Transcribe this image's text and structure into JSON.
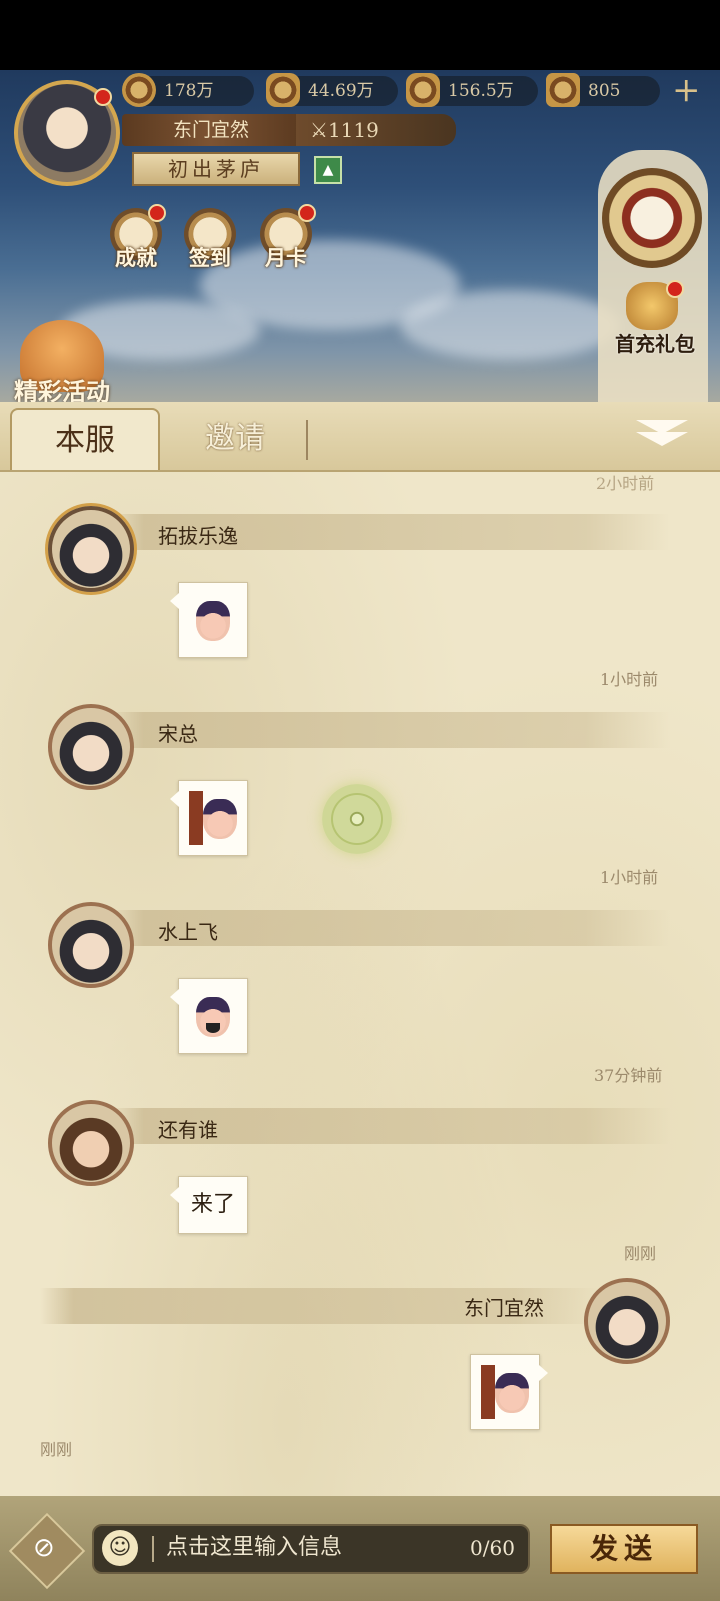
{
  "resources": [
    {
      "name": "coin",
      "value": "178万"
    },
    {
      "name": "scroll",
      "value": "44.69万"
    },
    {
      "name": "brush",
      "value": "156.5万"
    },
    {
      "name": "ticket",
      "value": "805"
    }
  ],
  "add_label": "+",
  "player": {
    "name": "东门宜然",
    "power": "1119",
    "rank": "初出茅庐"
  },
  "shortcuts": [
    {
      "label": "成就"
    },
    {
      "label": "签到"
    },
    {
      "label": "月卡"
    }
  ],
  "right_panel": {
    "gift_label": "首充礼包"
  },
  "event_label": "精彩活动",
  "tabs": [
    {
      "label": "本服",
      "active": true
    },
    {
      "label": "邀请",
      "active": false
    }
  ],
  "top_time_partial": "2小时前",
  "messages": [
    {
      "sender": "拓拔乐逸",
      "content_type": "sticker",
      "time": "1小时前"
    },
    {
      "sender": "宋总",
      "content_type": "sticker",
      "time": "1小时前"
    },
    {
      "sender": "水上飞",
      "content_type": "sticker",
      "time": "37分钟前"
    },
    {
      "sender": "还有谁",
      "content_type": "text",
      "text": "来了",
      "time": "刚刚"
    },
    {
      "sender": "东门宜然",
      "content_type": "sticker",
      "time": "刚刚",
      "self": true
    }
  ],
  "input": {
    "placeholder": "点击这里输入信息",
    "count": "0/60"
  },
  "send_label": "发送",
  "colors": {
    "panel_bg": "#efe6c9",
    "send_button": "#e0b35e",
    "red_dot": "#d3251b"
  }
}
